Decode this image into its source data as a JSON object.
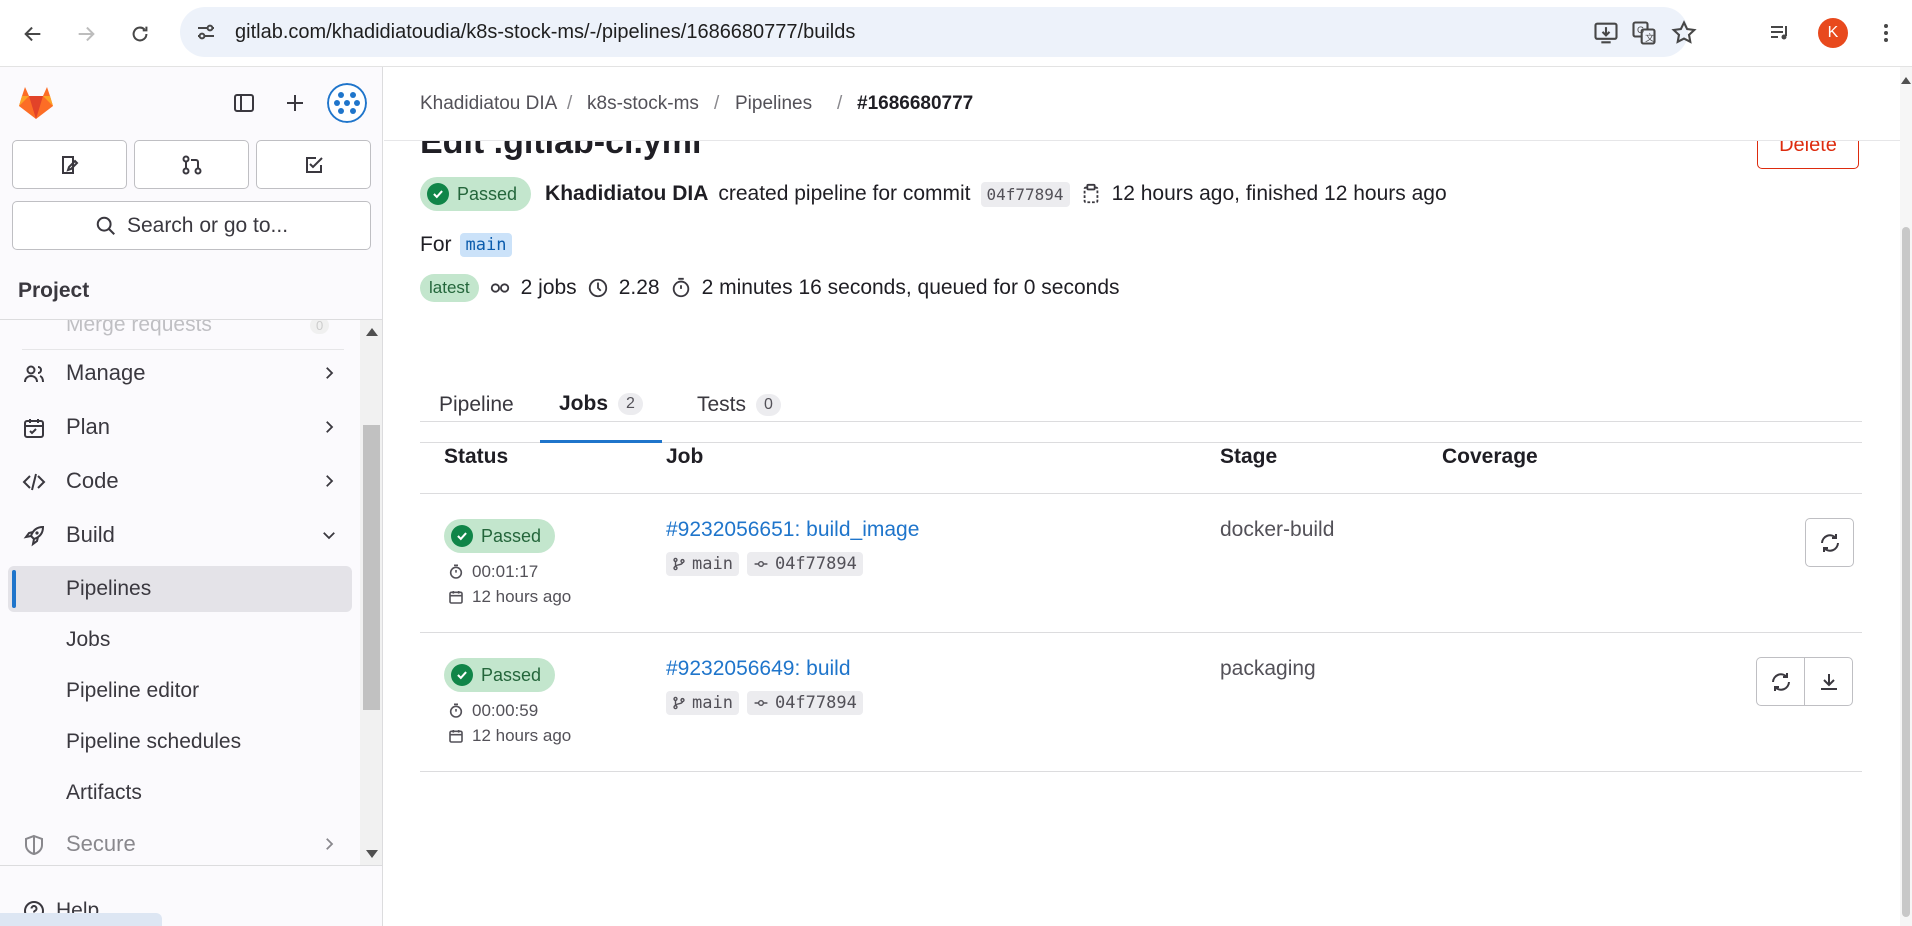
{
  "browser": {
    "url": "gitlab.com/khadidiatoudia/k8s-stock-ms/-/pipelines/1686680777/builds",
    "profile_initial": "K"
  },
  "sidebar": {
    "search_label": "Search or go to...",
    "section_title": "Project",
    "partial_item": "Merge requests",
    "partial_count": "0",
    "items": [
      {
        "label": "Manage"
      },
      {
        "label": "Plan"
      },
      {
        "label": "Code"
      },
      {
        "label": "Build"
      }
    ],
    "build_subitems": [
      {
        "label": "Pipelines"
      },
      {
        "label": "Jobs"
      },
      {
        "label": "Pipeline editor"
      },
      {
        "label": "Pipeline schedules"
      },
      {
        "label": "Artifacts"
      }
    ],
    "secure_label": "Secure",
    "help_label": "Help"
  },
  "breadcrumb": [
    "Khadidiatou DIA",
    "k8s-stock-ms",
    "Pipelines",
    "#1686680777"
  ],
  "pipeline": {
    "title": "Edit .gitlab-ci.yml",
    "delete_label": "Delete",
    "status": "Passed",
    "author": "Khadidiatou DIA",
    "created_text": "created pipeline for commit",
    "commit_sha": "04f77894",
    "time_text": "12 hours ago, finished 12 hours ago",
    "for_label": "For",
    "branch": "main",
    "latest_label": "latest",
    "jobs_count": "2 jobs",
    "compute": "2.28",
    "duration": "2 minutes 16 seconds, queued for 0 seconds"
  },
  "tabs": [
    {
      "label": "Pipeline"
    },
    {
      "label": "Jobs",
      "count": "2"
    },
    {
      "label": "Tests",
      "count": "0"
    }
  ],
  "table": {
    "headers": [
      "Status",
      "Job",
      "Stage",
      "Coverage"
    ],
    "rows": [
      {
        "status": "Passed",
        "duration": "00:01:17",
        "finished": "12 hours ago",
        "job": "#9232056651: build_image",
        "branch": "main",
        "sha": "04f77894",
        "stage": "docker-build"
      },
      {
        "status": "Passed",
        "duration": "00:00:59",
        "finished": "12 hours ago",
        "job": "#9232056649: build",
        "branch": "main",
        "sha": "04f77894",
        "stage": "packaging"
      }
    ]
  },
  "colors": {
    "accent": "#1f75cb",
    "passed": "#108548",
    "danger": "#dd2b0e",
    "gitlab_orange": "#fc6d26"
  }
}
